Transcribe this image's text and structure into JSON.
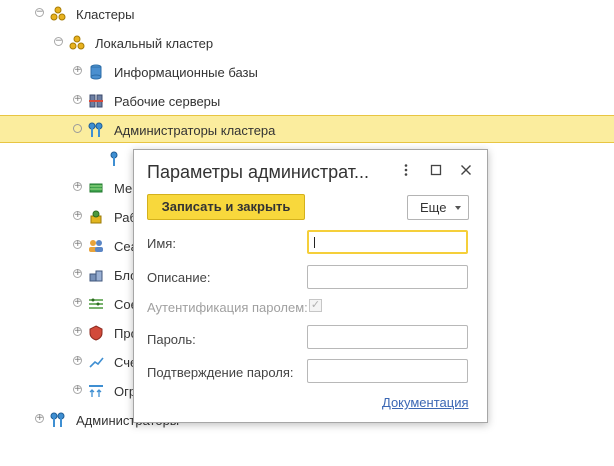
{
  "tree": {
    "clusters_label": "Кластеры",
    "local_cluster_label": "Локальный кластер",
    "items": [
      {
        "label": "Информационные базы"
      },
      {
        "label": "Рабочие серверы"
      },
      {
        "label": "Администраторы кластера"
      }
    ],
    "partial_items": [
      "Ме",
      "Раб",
      "Сеа",
      "Бло",
      "Сое",
      "Про",
      "Сче",
      "Огр"
    ],
    "administrators_label": "Администраторы"
  },
  "dialog": {
    "title": "Параметры администрат...",
    "save_close_label": "Записать и закрыть",
    "more_label": "Еще",
    "fields": {
      "name_label": "Имя:",
      "name_value": "",
      "description_label": "Описание:",
      "description_value": "",
      "password_auth_label": "Аутентификация паролем:",
      "password_auth_checked": true,
      "password_label": "Пароль:",
      "password_value": "",
      "confirm_label": "Подтверждение пароля:",
      "confirm_value": ""
    },
    "doc_link": "Документация"
  },
  "colors": {
    "selection": "#fbed9e",
    "primary_button": "#f8d83c",
    "link": "#3b67b4"
  }
}
